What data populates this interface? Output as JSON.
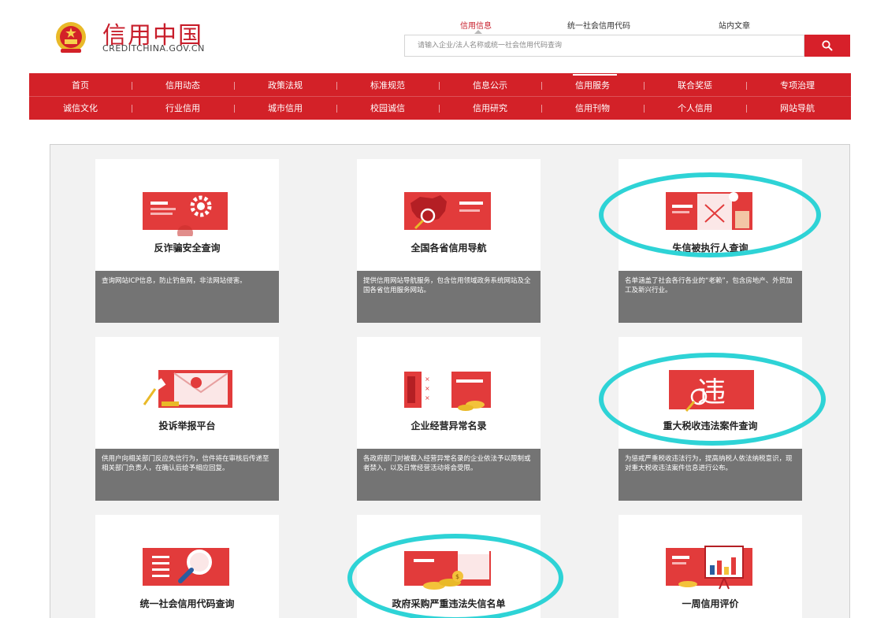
{
  "header": {
    "title": "信用中国",
    "domain": "CREDITCHINA.GOV.CN",
    "search_tabs": [
      "信用信息",
      "统一社会信用代码",
      "站内文章"
    ],
    "search_placeholder": "请输入企业/法人名称或统一社会信用代码查询"
  },
  "nav": {
    "row1": [
      "首页",
      "信用动态",
      "政策法规",
      "标准规范",
      "信息公示",
      "信用服务",
      "联合奖惩",
      "专项治理"
    ],
    "row2": [
      "诚信文化",
      "行业信用",
      "城市信用",
      "校园诚信",
      "信用研究",
      "信用刊物",
      "个人信用",
      "网站导航"
    ],
    "active": "信用服务"
  },
  "cards": [
    {
      "title": "反诈骗安全查询",
      "icon": "gear-screen-icon",
      "desc": "查询网站ICP信息，防止钓鱼网，非法网站侵害。"
    },
    {
      "title": "全国各省信用导航",
      "icon": "china-map-icon",
      "desc": "提供信用网站导航服务，包含信用领域政务系统网站及全国各省信用服务网站。"
    },
    {
      "title": "失信被执行人查询",
      "icon": "dishonest-document-icon",
      "desc": "名单涵盖了社会各行各业的“老赖”，包含房地产、外贸加工及新兴行业。"
    },
    {
      "title": "投诉举报平台",
      "icon": "envelope-gavel-icon",
      "desc": "供用户向相关部门反应失信行为，信件将在审核后传递至相关部门负责人，在确认后给予相应回复。"
    },
    {
      "title": "企业经营异常名录",
      "icon": "abnormal-list-icon",
      "desc": "各政府部门对被载入经营异常名录的企业依法予以限制或者禁入，以及日常经营活动将会受限。"
    },
    {
      "title": "重大税收违法案件查询",
      "icon": "tax-violation-icon",
      "desc": "为惩戒严重税收违法行为，提高纳税人依法纳税意识，现对重大税收违法案件信息进行公布。"
    },
    {
      "title": "统一社会信用代码查询",
      "icon": "magnifier-document-icon",
      "desc": ""
    },
    {
      "title": "政府采购严重违法失信名单",
      "icon": "procurement-store-icon",
      "desc": ""
    },
    {
      "title": "一周信用评价",
      "icon": "chart-board-icon",
      "desc": ""
    }
  ],
  "colors": {
    "brand_red": "#d32128",
    "highlight_cyan": "#2ed3d6",
    "desc_gray": "#747474"
  }
}
